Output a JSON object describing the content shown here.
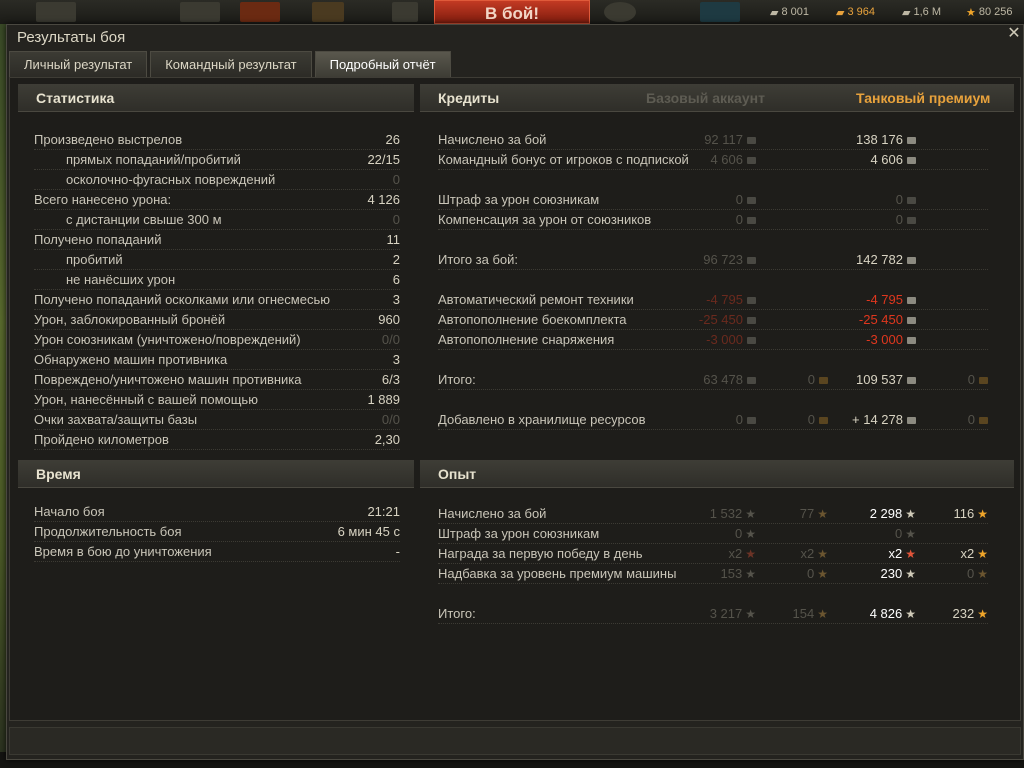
{
  "hud": {
    "battle_button": "В бой!",
    "free_xp": "8 001",
    "gold": "3 964",
    "credits": "1,6 M",
    "xp": "80 256"
  },
  "window": {
    "title": "Результаты боя",
    "close_glyph": "✕"
  },
  "tabs": [
    {
      "label": "Личный результат"
    },
    {
      "label": "Командный результат"
    },
    {
      "label": "Подробный отчёт"
    }
  ],
  "stats": {
    "title": "Статистика",
    "rows": [
      {
        "label": "Произведено выстрелов",
        "value": "26"
      },
      {
        "label": "прямых попаданий/пробитий",
        "value": "22/15"
      },
      {
        "label": "осколочно-фугасных повреждений",
        "value": "0"
      },
      {
        "label": "Всего нанесено урона:",
        "value": "4 126"
      },
      {
        "label": "с дистанции свыше 300 м",
        "value": "0"
      },
      {
        "label": "Получено попаданий",
        "value": "11"
      },
      {
        "label": "пробитий",
        "value": "2"
      },
      {
        "label": "не нанёсших урон",
        "value": "6"
      },
      {
        "label": "Получено попаданий осколками или огнесмесью",
        "value": "3"
      },
      {
        "label": "Урон, заблокированный бронёй",
        "value": "960"
      },
      {
        "label": "Урон союзникам (уничтожено/повреждений)",
        "value": "0/0"
      },
      {
        "label": "Обнаружено машин противника",
        "value": "3"
      },
      {
        "label": "Повреждено/уничтожено машин противника",
        "value": "6/3"
      },
      {
        "label": "Урон, нанесённый с вашей помощью",
        "value": "1 889"
      },
      {
        "label": "Очки захвата/защиты базы",
        "value": "0/0"
      },
      {
        "label": "Пройдено километров",
        "value": "2,30"
      }
    ]
  },
  "time": {
    "title": "Время",
    "rows": [
      {
        "label": "Начало боя",
        "value": "21:21"
      },
      {
        "label": "Продолжительность боя",
        "value": "6 мин 45 с"
      },
      {
        "label": "Время в бою до уничтожения",
        "value": "-"
      }
    ]
  },
  "credits": {
    "title": "Кредиты",
    "col_base": "Базовый аккаунт",
    "col_premium": "Танковый премиум",
    "rows": [
      {
        "label": "Начислено за бой",
        "base": "92 117",
        "premium": "138 176"
      },
      {
        "label": "Командный бонус от игроков с подпиской",
        "base": "4 606",
        "premium": "4 606"
      },
      {
        "label": "Штраф за урон союзникам",
        "base": "0",
        "premium": "0"
      },
      {
        "label": "Компенсация за урон от союзников",
        "base": "0",
        "premium": "0"
      },
      {
        "label": "Итого за бой:",
        "base": "96 723",
        "premium": "142 782"
      },
      {
        "label": "Автоматический ремонт техники",
        "base": "-4 795",
        "premium": "-4 795"
      },
      {
        "label": "Автопополнение боекомплекта",
        "base": "-25 450",
        "premium": "-25 450"
      },
      {
        "label": "Автопополнение снаряжения",
        "base": "-3 000",
        "premium": "-3 000"
      },
      {
        "label": "Итого:",
        "base": "63 478",
        "base_gold": "0",
        "premium": "109 537",
        "premium_gold": "0"
      },
      {
        "label": "Добавлено в хранилище ресурсов",
        "base": "0",
        "base_extra": "0",
        "premium": "+ 14 278",
        "premium_extra": "0"
      }
    ]
  },
  "experience": {
    "title": "Опыт",
    "rows": [
      {
        "label": "Начислено за бой",
        "base": "1 532",
        "base_free": "77",
        "premium": "2 298",
        "premium_free": "116"
      },
      {
        "label": "Штраф за урон союзникам",
        "base": "0",
        "premium": "0"
      },
      {
        "label": "Награда за первую победу в день",
        "base": "x2",
        "base_free": "x2",
        "premium": "x2",
        "premium_free": "x2"
      },
      {
        "label": "Надбавка за уровень премиум машины",
        "base": "153",
        "base_free": "0",
        "premium": "230",
        "premium_free": "0"
      },
      {
        "label": "Итого:",
        "base": "3 217",
        "base_free": "154",
        "premium": "4 826",
        "premium_free": "232"
      }
    ]
  },
  "colors": {
    "premium_accent": "#e8a23c",
    "penalty_red": "#e0371e",
    "panel_bg": "#1e1d1a"
  }
}
